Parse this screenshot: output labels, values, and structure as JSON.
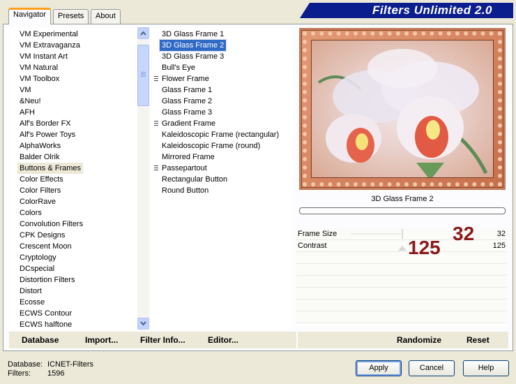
{
  "tabs": [
    {
      "label": "Navigator",
      "active": true
    },
    {
      "label": "Presets",
      "active": false
    },
    {
      "label": "About",
      "active": false
    }
  ],
  "banner": {
    "title": "Filters Unlimited 2.0"
  },
  "categories": [
    {
      "label": "VM Experimental"
    },
    {
      "label": "VM Extravaganza"
    },
    {
      "label": "VM Instant Art"
    },
    {
      "label": "VM Natural"
    },
    {
      "label": "VM Toolbox"
    },
    {
      "label": "VM"
    },
    {
      "label": "&Neu!"
    },
    {
      "label": "AFH"
    },
    {
      "label": "Alf's Border FX"
    },
    {
      "label": "Alf's Power Toys"
    },
    {
      "label": "AlphaWorks"
    },
    {
      "label": "Balder Olrik"
    },
    {
      "label": "Buttons & Frames",
      "state": "hilite"
    },
    {
      "label": "Color Effects"
    },
    {
      "label": "Color Filters"
    },
    {
      "label": "ColorRave"
    },
    {
      "label": "Colors"
    },
    {
      "label": "Convolution Filters"
    },
    {
      "label": "CPK Designs"
    },
    {
      "label": "Crescent Moon"
    },
    {
      "label": "Cryptology"
    },
    {
      "label": "DCspecial"
    },
    {
      "label": "Distortion Filters"
    },
    {
      "label": "Distort"
    },
    {
      "label": "Ecosse"
    },
    {
      "label": "ECWS Contour"
    },
    {
      "label": "ECWS halftone"
    }
  ],
  "filters": [
    {
      "label": "3D Glass Frame 1",
      "grip": false
    },
    {
      "label": "3D Glass Frame 2",
      "grip": false,
      "state": "selected"
    },
    {
      "label": "3D Glass Frame 3",
      "grip": false
    },
    {
      "label": "Bull's Eye",
      "grip": false
    },
    {
      "label": "Flower Frame",
      "grip": true
    },
    {
      "label": "Glass Frame 1",
      "grip": false
    },
    {
      "label": "Glass Frame 2",
      "grip": false
    },
    {
      "label": "Glass Frame 3",
      "grip": false
    },
    {
      "label": "Gradient Frame",
      "grip": true
    },
    {
      "label": "Kaleidoscopic Frame (rectangular)",
      "grip": false
    },
    {
      "label": "Kaleidoscopic Frame (round)",
      "grip": false
    },
    {
      "label": "Mirrored Frame",
      "grip": false
    },
    {
      "label": "Passepartout",
      "grip": true
    },
    {
      "label": "Rectangular Button",
      "grip": false
    },
    {
      "label": "Round Button",
      "grip": false
    }
  ],
  "menu": {
    "database": "Database",
    "import": "Import...",
    "filter_info": "Filter Info...",
    "editor": "Editor...",
    "randomize": "Randomize",
    "reset": "Reset"
  },
  "preview": {
    "filter_name": "3D Glass Frame 2"
  },
  "params": [
    {
      "label": "Frame Size",
      "value": "32"
    },
    {
      "label": "Contrast",
      "value": "125"
    }
  ],
  "annotations": {
    "frame_size": "32",
    "contrast": "125"
  },
  "status": {
    "database_label": "Database:",
    "database_value": "ICNET-Filters",
    "filters_label": "Filters:",
    "filters_value": "1596"
  },
  "buttons": {
    "apply": "Apply",
    "cancel": "Cancel",
    "help": "Help"
  },
  "colors": {
    "banner": "#0b1e8e",
    "selection": "#316ac5",
    "annotation": "#8b1a1a"
  },
  "icons": {
    "scroll_up": "chevron-up-icon",
    "scroll_down": "chevron-down-icon"
  }
}
